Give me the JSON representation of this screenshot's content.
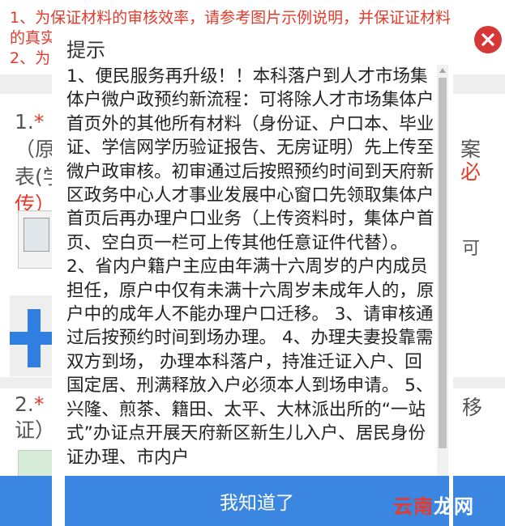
{
  "background": {
    "notice_line1": "1、为保证材料的审核效率，请参考图片示例说明，并保证证材料",
    "notice_line2": "的真实",
    "notice_line3": "2、为",
    "q1_prefix": "1.",
    "q1_star": "*",
    "q1_fragment1": "",
    "q1_line2": "（原",
    "q1_right_line2": "案",
    "q1_line3": "表(学",
    "q1_right_line3": "必",
    "q1_line4": "传）",
    "q1_right_line4": "可",
    "q2_prefix": "2.",
    "q2_star": "*",
    "q2_line2": "证）",
    "q2_right": "移"
  },
  "modal": {
    "title": "提示",
    "body": "1、便民服务再升级！！本科落户到人才市场集体户微户政预约新流程：可将除人才市场集体户首页外的其他所有材料（身份证、户口本、毕业证、学信网学历验证报告、无房证明）先上传至微户政审核。初审通过后按照预约时间到天府新区政务中心人才事业发展中心窗口先领取集体户首页后再办理户口业务（上传资料时，集体户首页、空白页一栏可上传其他任意证件代替）。 2、省内户籍户主应由年满十六周岁的户内成员担任，原户中仅有未满十六周岁未成年人的，原户中的成年人不能办理户口迁移。 3、请审核通过后按预约时间到场办理。 4、办理夫妻投靠需双方到场， 办理本科落户，持准迁证入户、回国定居、刑满释放入户必须本人到场申请。 5、兴隆、煎茶、籍田、太平、大林派出所的“一站式”办证点开展天府新区新生儿入户、居民身份证办理、市内户",
    "confirm_label": "我知道了"
  },
  "watermark": {
    "part_red": "云南",
    "part_white": "龙网"
  },
  "colors": {
    "primary_blue": "#3a86e0",
    "notice_red": "#e03b2b",
    "close_red": "#d63838"
  }
}
